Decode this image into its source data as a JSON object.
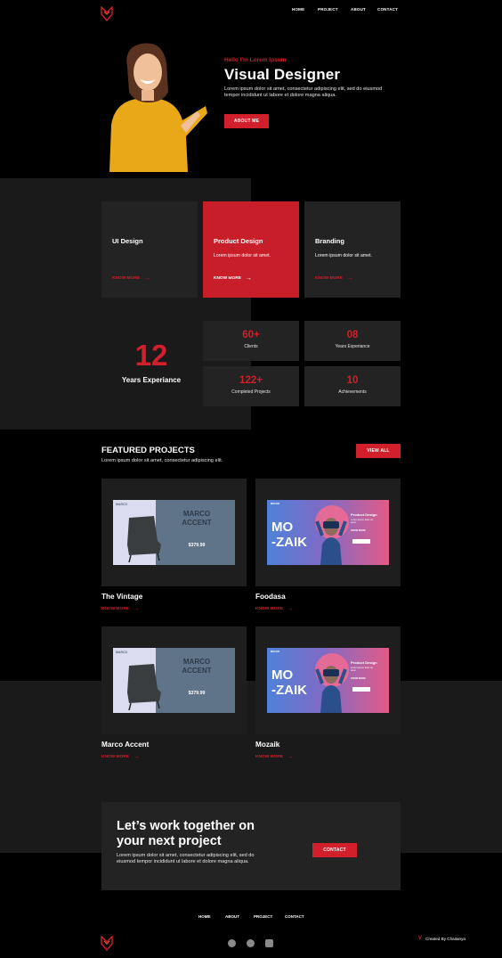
{
  "nav": {
    "items": [
      "HOME",
      "PROJECT",
      "ABOUT",
      "CONTACT"
    ]
  },
  "hero": {
    "hello": "Hello I'm Lorem Ipsum",
    "title": "Visual Designer",
    "text": "Lorem ipsum dolor sit amet, consectetur adipiscing elit, sed do eiusmod tempor incididunt ut labore et dolore magna aliqua.",
    "button": "ABOUT ME"
  },
  "services": [
    {
      "title": "UI Design",
      "text": "",
      "more": "KNOW MORE"
    },
    {
      "title": "Product Design",
      "text": "Lorem ipsum dolor sit amet.",
      "more": "KNOW MORE"
    },
    {
      "title": "Branding",
      "text": "Lorem ipsum dolor sit amet.",
      "more": "KNOW MORE"
    }
  ],
  "experience": {
    "number": "12",
    "label": "Years Experiance"
  },
  "stats": [
    {
      "value": "60+",
      "label": "Clients"
    },
    {
      "value": "08",
      "label": "Years Experiance"
    },
    {
      "value": "122+",
      "label": "Completed Projects"
    },
    {
      "value": "10",
      "label": "Achievements"
    }
  ],
  "featured": {
    "title": "FEATURED PROJECTS",
    "subtitle": "Lorem ipsum dolor sit amet, consectetur adipiscing elit.",
    "view_all": "VIEW ALL"
  },
  "marco_thumb": {
    "brand": "MARCO",
    "name_line1": "MARCO",
    "name_line2": "ACCENT",
    "price": "$379.99"
  },
  "mozaik_thumb": {
    "brand": "MOZAIK",
    "name_line1": "MO",
    "name_line2": "-ZAIK",
    "title": "Product Design",
    "text": "Lorem ipsum dolor sit amet",
    "more": "KNOW MORE"
  },
  "projects": [
    {
      "name": "The Vintage",
      "more": "KNOW MORE"
    },
    {
      "name": "Foodasa",
      "more": "KNOW MORE"
    },
    {
      "name": "Marco Accent",
      "more": "KNOW MORE"
    },
    {
      "name": "Mozaik",
      "more": "KNOW MORE"
    }
  ],
  "cta": {
    "title_line1": "Let’s work together on",
    "title_line2": "your next project",
    "text": "Lorem ipsum dolor sit amet, consectetur adipiscing elit, sed do eiusmod tempor incididunt ut labore et dolore magna aliqua.",
    "button": "CONTACT"
  },
  "footer": {
    "links": [
      "HOME",
      "ABOUT",
      "PROJECT",
      "CONTACT"
    ],
    "credit": "Created By Chaitanya",
    "social_icons": [
      "facebook-icon",
      "twitter-icon",
      "youtube-icon"
    ]
  },
  "colors": {
    "accent": "#d11f2b",
    "background": "#000000",
    "panel": "#1a1a1a",
    "card": "#232323"
  }
}
